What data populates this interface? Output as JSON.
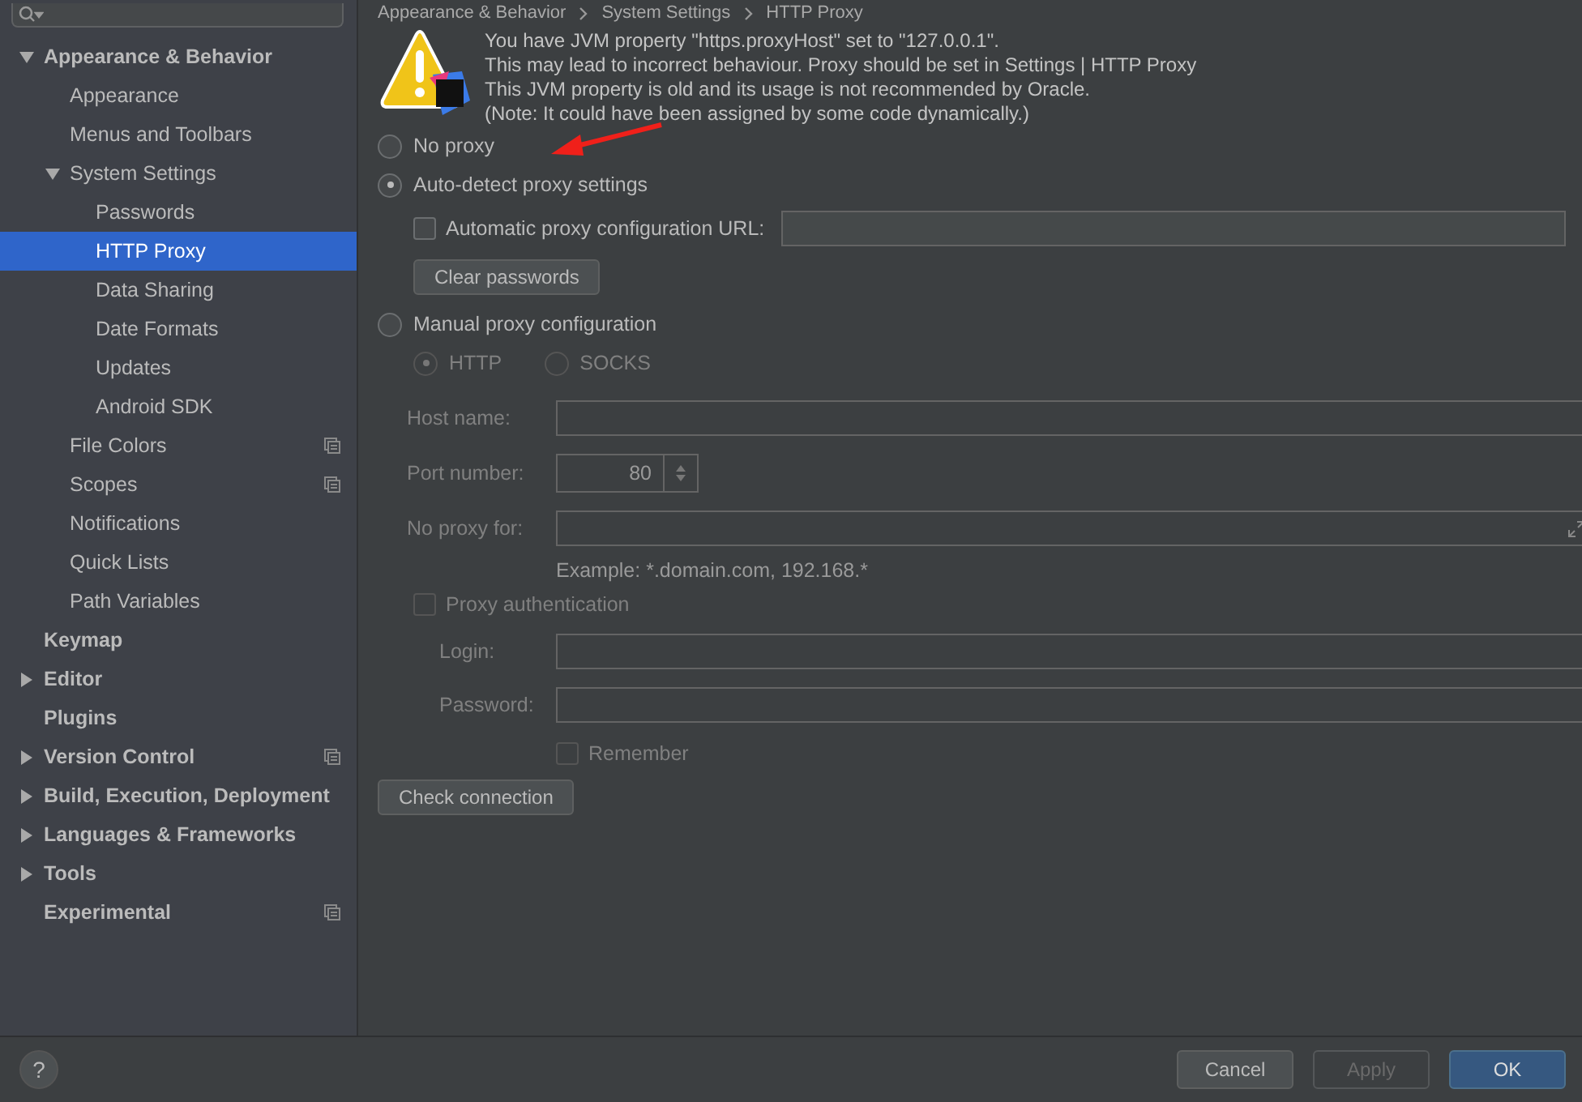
{
  "breadcrumb": [
    "Appearance & Behavior",
    "System Settings",
    "HTTP Proxy"
  ],
  "sidebar": {
    "items": [
      {
        "label": "Appearance & Behavior",
        "expanded": true,
        "selected": false,
        "scoped": false,
        "children": [
          {
            "label": "Appearance",
            "selected": false,
            "scoped": false
          },
          {
            "label": "Menus and Toolbars",
            "selected": false,
            "scoped": false
          },
          {
            "label": "System Settings",
            "expanded": true,
            "selected": false,
            "scoped": false,
            "children": [
              {
                "label": "Passwords",
                "selected": false,
                "scoped": false
              },
              {
                "label": "HTTP Proxy",
                "selected": true,
                "scoped": false
              },
              {
                "label": "Data Sharing",
                "selected": false,
                "scoped": false
              },
              {
                "label": "Date Formats",
                "selected": false,
                "scoped": false
              },
              {
                "label": "Updates",
                "selected": false,
                "scoped": false
              },
              {
                "label": "Android SDK",
                "selected": false,
                "scoped": false
              }
            ]
          },
          {
            "label": "File Colors",
            "selected": false,
            "scoped": true
          },
          {
            "label": "Scopes",
            "selected": false,
            "scoped": true
          },
          {
            "label": "Notifications",
            "selected": false,
            "scoped": false
          },
          {
            "label": "Quick Lists",
            "selected": false,
            "scoped": false
          },
          {
            "label": "Path Variables",
            "selected": false,
            "scoped": false
          }
        ]
      },
      {
        "label": "Keymap",
        "selected": false,
        "scoped": false
      },
      {
        "label": "Editor",
        "expanded": false,
        "selected": false,
        "scoped": false
      },
      {
        "label": "Plugins",
        "selected": false,
        "scoped": false
      },
      {
        "label": "Version Control",
        "expanded": false,
        "selected": false,
        "scoped": true
      },
      {
        "label": "Build, Execution, Deployment",
        "expanded": false,
        "selected": false,
        "scoped": false
      },
      {
        "label": "Languages & Frameworks",
        "expanded": false,
        "selected": false,
        "scoped": false
      },
      {
        "label": "Tools",
        "expanded": false,
        "selected": false,
        "scoped": false
      },
      {
        "label": "Experimental",
        "selected": false,
        "scoped": true
      }
    ]
  },
  "warning": {
    "lines": [
      "You have JVM property \"https.proxyHost\" set to \"127.0.0.1\".",
      "This may lead to incorrect behaviour. Proxy should be set in Settings | HTTP Proxy",
      "This JVM property is old and its usage is not recommended by Oracle.",
      "(Note: It could have been assigned by some code dynamically.)"
    ]
  },
  "proxy_modes": [
    {
      "label": "No proxy",
      "selected": false
    },
    {
      "label": "Auto-detect proxy settings",
      "selected": true
    },
    {
      "label": "Manual proxy configuration",
      "selected": false
    }
  ],
  "auto": {
    "pac_checkbox": {
      "label": "Automatic proxy configuration URL:",
      "checked": false
    },
    "clear_button": "Clear passwords"
  },
  "manual": {
    "disabled": true,
    "protocols": [
      {
        "label": "HTTP",
        "selected": true
      },
      {
        "label": "SOCKS",
        "selected": false
      }
    ],
    "host": {
      "label": "Host name:"
    },
    "port": {
      "label": "Port number:",
      "value": "80"
    },
    "no_proxy": {
      "label": "No proxy for:"
    },
    "example": "Example: *.domain.com, 192.168.*",
    "auth_checkbox": {
      "label": "Proxy authentication",
      "checked": false
    },
    "login": {
      "label": "Login:"
    },
    "password": {
      "label": "Password:"
    },
    "remember": {
      "label": "Remember",
      "checked": false
    }
  },
  "check_button": "Check connection",
  "annotation_arrow": true,
  "help_button": "?",
  "buttons": [
    {
      "label": "Cancel",
      "kind": "normal",
      "disabled": false
    },
    {
      "label": "Apply",
      "kind": "normal",
      "disabled": true
    },
    {
      "label": "OK",
      "kind": "default",
      "disabled": false
    }
  ]
}
